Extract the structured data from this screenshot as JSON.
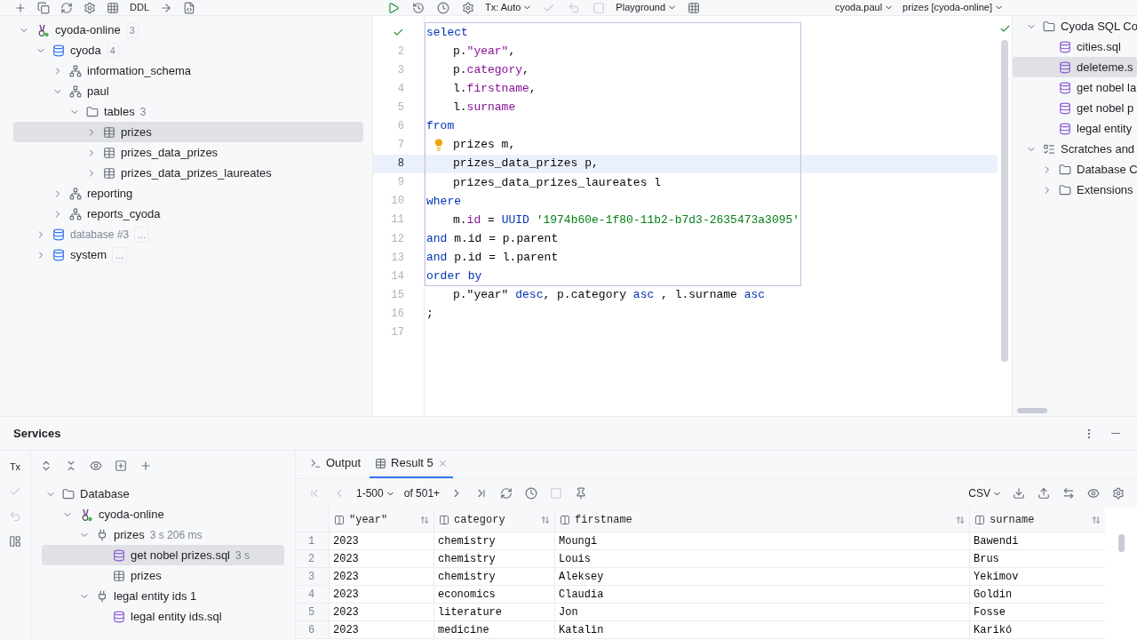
{
  "toolbar": {
    "ddl": "DDL",
    "tx_mode": "Tx: Auto",
    "playground": "Playground",
    "schema": "cyoda.paul",
    "session": "prizes [cyoda-online]"
  },
  "db_tree": [
    {
      "label": "cyoda-online",
      "kind": "connection",
      "count": "3",
      "expanded": true,
      "selected": false,
      "children": [
        {
          "label": "cyoda",
          "kind": "database",
          "count": "4",
          "expanded": true,
          "selected": false,
          "children": [
            {
              "label": "information_schema",
              "kind": "schema",
              "expanded": false,
              "selected": false
            },
            {
              "label": "paul",
              "kind": "schema",
              "expanded": true,
              "selected": false,
              "children": [
                {
                  "label": "tables",
                  "kind": "folder",
                  "note": "3",
                  "expanded": true,
                  "selected": false,
                  "children": [
                    {
                      "label": "prizes",
                      "kind": "table",
                      "expanded": false,
                      "selected": true
                    },
                    {
                      "label": "prizes_data_prizes",
                      "kind": "table",
                      "expanded": false,
                      "selected": false
                    },
                    {
                      "label": "prizes_data_prizes_laureates",
                      "kind": "table",
                      "expanded": false,
                      "selected": false
                    }
                  ]
                }
              ]
            },
            {
              "label": "reporting",
              "kind": "schema",
              "expanded": false,
              "selected": false
            },
            {
              "label": "reports_cyoda",
              "kind": "schema",
              "expanded": false,
              "selected": false
            }
          ]
        },
        {
          "label": "database #3",
          "kind": "database",
          "count": "...",
          "muted": true,
          "expanded": false,
          "selected": false
        },
        {
          "label": "system",
          "kind": "database",
          "count": "...",
          "expanded": false,
          "selected": false
        }
      ]
    }
  ],
  "editor": {
    "lines": [
      {
        "kind": "checked",
        "current": false,
        "tokens": [
          {
            "kind": "kw",
            "text": "select"
          }
        ]
      },
      {
        "number": "2",
        "indent": true,
        "current": false,
        "tokens": [
          {
            "kind": "plain",
            "text": "p."
          },
          {
            "kind": "field",
            "text": "\"year\""
          },
          {
            "kind": "plain",
            "text": ","
          }
        ]
      },
      {
        "number": "3",
        "indent": true,
        "current": false,
        "tokens": [
          {
            "kind": "plain",
            "text": "p."
          },
          {
            "kind": "field",
            "text": "category"
          },
          {
            "kind": "plain",
            "text": ","
          }
        ]
      },
      {
        "number": "4",
        "indent": true,
        "current": false,
        "tokens": [
          {
            "kind": "plain",
            "text": "l."
          },
          {
            "kind": "field",
            "text": "firstname"
          },
          {
            "kind": "plain",
            "text": ","
          }
        ]
      },
      {
        "number": "5",
        "indent": true,
        "current": false,
        "tokens": [
          {
            "kind": "plain",
            "text": "l."
          },
          {
            "kind": "field",
            "text": "surname"
          }
        ]
      },
      {
        "number": "6",
        "current": false,
        "tokens": [
          {
            "kind": "kw",
            "text": "from"
          }
        ]
      },
      {
        "number": "7",
        "indent": true,
        "kind": "hint",
        "current": false,
        "tokens": [
          {
            "kind": "plain",
            "text": "prizes m,"
          }
        ]
      },
      {
        "number": "8",
        "indent": true,
        "current": true,
        "tokens": [
          {
            "kind": "plain",
            "text": "prizes_data_prizes p,"
          }
        ]
      },
      {
        "number": "9",
        "indent": true,
        "current": false,
        "tokens": [
          {
            "kind": "plain",
            "text": "prizes_data_prizes_laureates l"
          }
        ]
      },
      {
        "number": "10",
        "current": false,
        "tokens": [
          {
            "kind": "kw",
            "text": "where"
          }
        ]
      },
      {
        "number": "11",
        "indent": true,
        "current": false,
        "tokens": [
          {
            "kind": "plain",
            "text": "m."
          },
          {
            "kind": "field",
            "text": "id"
          },
          {
            "kind": "plain",
            "text": " = "
          },
          {
            "kind": "kw",
            "text": "UUID"
          },
          {
            "kind": "str",
            "text": " '1974b60e-1f80-11b2-b7d3-2635473a3095'"
          }
        ]
      },
      {
        "number": "12",
        "current": false,
        "tokens": [
          {
            "kind": "kw",
            "text": "and"
          },
          {
            "kind": "plain",
            "text": " m.id = p.parent"
          }
        ]
      },
      {
        "number": "13",
        "current": false,
        "tokens": [
          {
            "kind": "kw",
            "text": "and"
          },
          {
            "kind": "plain",
            "text": " p.id = l.parent"
          }
        ]
      },
      {
        "number": "14",
        "current": false,
        "tokens": [
          {
            "kind": "kw",
            "text": "order by"
          }
        ]
      },
      {
        "number": "15",
        "indent": true,
        "current": false,
        "tokens": [
          {
            "kind": "plain",
            "text": "p.\"year\""
          },
          {
            "kind": "kw",
            "text": " desc"
          },
          {
            "kind": "plain",
            "text": ", p.category "
          },
          {
            "kind": "kw",
            "text": "asc"
          },
          {
            "kind": "plain",
            "text": " , l.surname "
          },
          {
            "kind": "kw",
            "text": "asc"
          }
        ]
      },
      {
        "number": "16",
        "current": false,
        "tokens": [
          {
            "kind": "plain",
            "text": ";"
          }
        ]
      },
      {
        "number": "17",
        "current": false
      }
    ]
  },
  "right_tree": [
    {
      "label": "Cyoda SQL Co",
      "kind": "folder",
      "expanded": true,
      "selected": false,
      "children": [
        {
          "label": "cities.sql",
          "kind": "sql",
          "selected": false
        },
        {
          "label": "deleteme.s",
          "kind": "sql",
          "selected": true
        },
        {
          "label": "get nobel la",
          "kind": "sql",
          "selected": false
        },
        {
          "label": "get nobel p",
          "kind": "sql",
          "selected": false
        },
        {
          "label": "legal entity",
          "kind": "sql",
          "selected": false
        }
      ]
    },
    {
      "label": "Scratches and",
      "kind": "scratches",
      "expanded": true,
      "selected": false,
      "children": [
        {
          "label": "Database C",
          "kind": "folder",
          "expanded": false,
          "selected": false
        },
        {
          "label": "Extensions",
          "kind": "folder",
          "expanded": false,
          "selected": false
        }
      ]
    }
  ],
  "services": {
    "title": "Services",
    "tx_label": "Tx",
    "tree": [
      {
        "label": "Database",
        "kind": "folder",
        "expanded": true,
        "selected": false,
        "children": [
          {
            "label": "cyoda-online",
            "kind": "connection",
            "expanded": true,
            "selected": false,
            "children": [
              {
                "label": "prizes",
                "kind": "session",
                "note": "3 s 206 ms",
                "expanded": true,
                "selected": false,
                "children": [
                  {
                    "label": "get nobel prizes.sql",
                    "kind": "sql",
                    "note": "3 s",
                    "selected": true
                  },
                  {
                    "label": "prizes",
                    "kind": "table",
                    "selected": false
                  }
                ]
              },
              {
                "label": "legal entity ids 1",
                "kind": "session",
                "expanded": true,
                "selected": false,
                "children": [
                  {
                    "label": "legal entity ids.sql",
                    "kind": "sql",
                    "selected": false
                  }
                ]
              }
            ]
          }
        ]
      }
    ]
  },
  "results": {
    "tabs": [
      {
        "label": "Output",
        "kind": "console",
        "selected": false
      },
      {
        "label": "Result 5",
        "kind": "table",
        "selected": true
      }
    ],
    "pager": {
      "range": "1-500",
      "total": "of 501+"
    },
    "format": "CSV",
    "columns": [
      "\"year\"",
      "category",
      "firstname",
      "surname"
    ],
    "rows": [
      {
        "number": "1",
        "cells": [
          "2023",
          "chemistry",
          "Moungi",
          "Bawendi"
        ]
      },
      {
        "number": "2",
        "cells": [
          "2023",
          "chemistry",
          "Louis",
          "Brus"
        ]
      },
      {
        "number": "3",
        "cells": [
          "2023",
          "chemistry",
          "Aleksey",
          "Yekimov"
        ]
      },
      {
        "number": "4",
        "cells": [
          "2023",
          "economics",
          "Claudia",
          "Goldin"
        ]
      },
      {
        "number": "5",
        "cells": [
          "2023",
          "literature",
          "Jon",
          "Fosse"
        ]
      },
      {
        "number": "6",
        "cells": [
          "2023",
          "medicine",
          "Katalin",
          "Karikó"
        ]
      }
    ]
  }
}
